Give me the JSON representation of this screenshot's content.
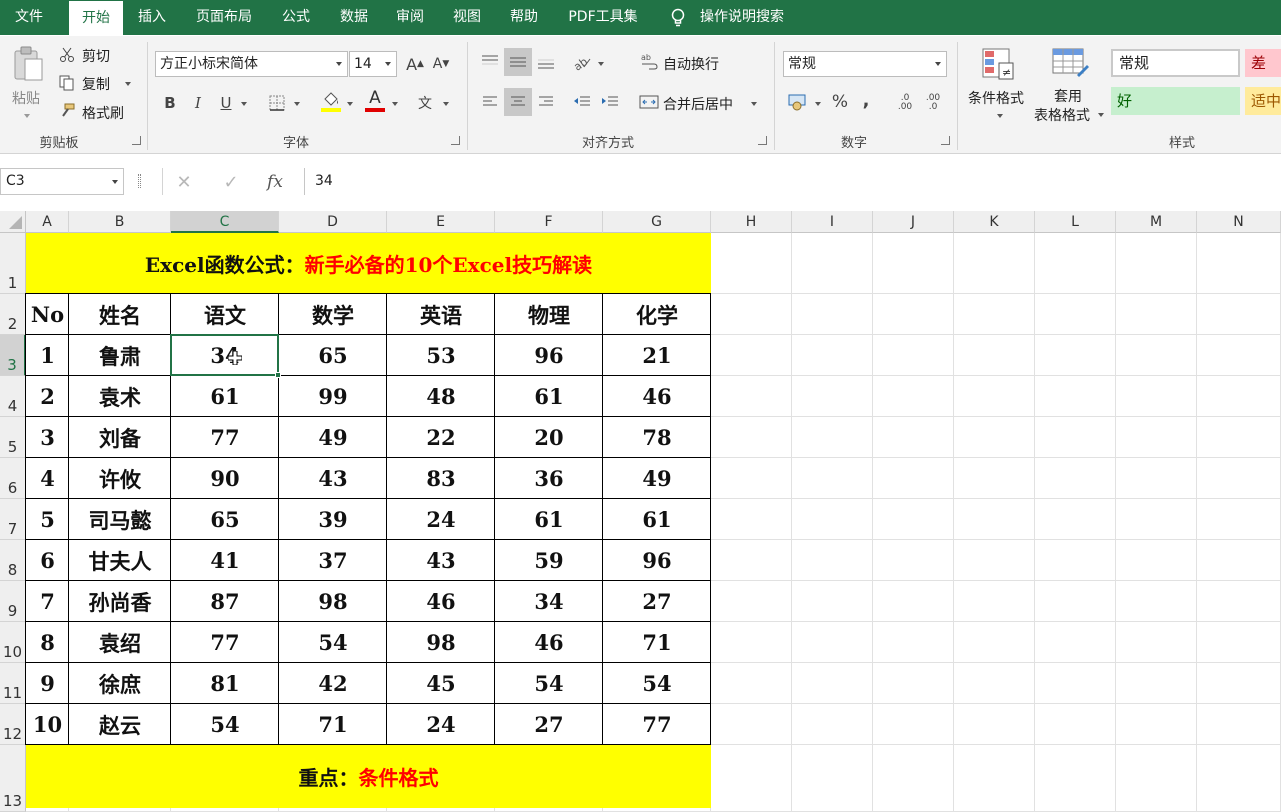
{
  "menu": {
    "file": "文件",
    "home": "开始",
    "insert": "插入",
    "layout": "页面布局",
    "formulas": "公式",
    "data": "数据",
    "review": "审阅",
    "view": "视图",
    "help": "帮助",
    "pdf": "PDF工具集",
    "search": "操作说明搜索"
  },
  "ribbon": {
    "clipboard": {
      "paste": "粘贴",
      "cut": "剪切",
      "copy": "复制",
      "format_painter": "格式刷",
      "label": "剪贴板"
    },
    "font": {
      "name": "方正小标宋简体",
      "size": "14",
      "grow": "A",
      "shrink": "A",
      "bold": "B",
      "italic": "I",
      "underline": "U",
      "font_color": "A",
      "phonetic": "文",
      "label": "字体"
    },
    "alignment": {
      "wrap": "自动换行",
      "merge": "合并后居中",
      "label": "对齐方式"
    },
    "number": {
      "format": "常规",
      "percent": "%",
      "comma": ",",
      "inc_decimal": ".0 .00",
      "dec_decimal": ".00 .0",
      "label": "数字"
    },
    "styles": {
      "conditional": "条件格式",
      "table_line1": "套用",
      "table_line2": "表格格式",
      "normal": "常规",
      "bad": "差",
      "good": "好",
      "neutral": "适中",
      "label": "样式"
    },
    "colors": {
      "menubar": "#217346",
      "good_bg": "#c6efce",
      "good_fg": "#006100",
      "bad_bg": "#ffc7ce",
      "bad_fg": "#9c0006",
      "neutral_bg": "#ffeb9c",
      "neutral_fg": "#9c5700"
    }
  },
  "formula_bar": {
    "name_box": "C3",
    "cancel": "✕",
    "enter": "✓",
    "fx": "fx",
    "content": "34"
  },
  "sheet": {
    "columns": [
      "A",
      "B",
      "C",
      "D",
      "E",
      "F",
      "G",
      "H",
      "I",
      "J",
      "K",
      "L",
      "M",
      "N"
    ],
    "rows": [
      "1",
      "2",
      "3",
      "4",
      "5",
      "6",
      "7",
      "8",
      "9",
      "10",
      "11",
      "12",
      "13"
    ],
    "selected_cell": "C3",
    "title_black": "Excel函数公式：",
    "title_red": "新手必备的10个Excel技巧解读",
    "headers": [
      "No",
      "姓名",
      "语文",
      "数学",
      "英语",
      "物理",
      "化学"
    ],
    "data_rows": [
      [
        "1",
        "鲁肃",
        "34",
        "65",
        "53",
        "96",
        "21"
      ],
      [
        "2",
        "袁术",
        "61",
        "99",
        "48",
        "61",
        "46"
      ],
      [
        "3",
        "刘备",
        "77",
        "49",
        "22",
        "20",
        "78"
      ],
      [
        "4",
        "许攸",
        "90",
        "43",
        "83",
        "36",
        "49"
      ],
      [
        "5",
        "司马懿",
        "65",
        "39",
        "24",
        "61",
        "61"
      ],
      [
        "6",
        "甘夫人",
        "41",
        "37",
        "43",
        "59",
        "96"
      ],
      [
        "7",
        "孙尚香",
        "87",
        "98",
        "46",
        "34",
        "27"
      ],
      [
        "8",
        "袁绍",
        "77",
        "54",
        "98",
        "46",
        "71"
      ],
      [
        "9",
        "徐庶",
        "81",
        "42",
        "45",
        "54",
        "54"
      ],
      [
        "10",
        "赵云",
        "54",
        "71",
        "24",
        "27",
        "77"
      ]
    ],
    "footer_black": "重点：",
    "footer_red": "条件格式",
    "highlight_color": "#ffff00",
    "red_text_color": "#ff0000"
  }
}
